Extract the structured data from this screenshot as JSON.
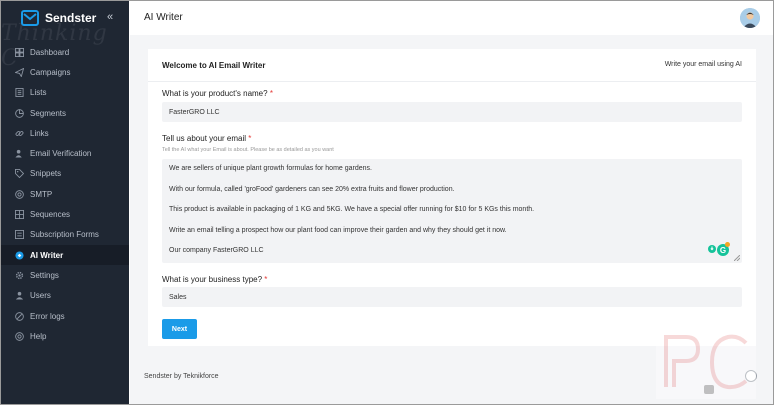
{
  "sidebar": {
    "brand": "Sendster",
    "watermark": "Thinking C",
    "items": [
      {
        "label": "Dashboard",
        "icon": "dashboard-icon",
        "active": false
      },
      {
        "label": "Campaigns",
        "icon": "paper-plane-icon",
        "active": false
      },
      {
        "label": "Lists",
        "icon": "list-icon",
        "active": false
      },
      {
        "label": "Segments",
        "icon": "pie-chart-icon",
        "active": false
      },
      {
        "label": "Links",
        "icon": "link-icon",
        "active": false
      },
      {
        "label": "Email Verification",
        "icon": "user-check-icon",
        "active": false
      },
      {
        "label": "Snippets",
        "icon": "tag-icon",
        "active": false
      },
      {
        "label": "SMTP",
        "icon": "at-sign-icon",
        "active": false
      },
      {
        "label": "Sequences",
        "icon": "grid-icon",
        "active": false
      },
      {
        "label": "Subscription Forms",
        "icon": "form-icon",
        "active": false
      },
      {
        "label": "AI Writer",
        "icon": "ai-icon",
        "active": true
      },
      {
        "label": "Settings",
        "icon": "gear-icon",
        "active": false
      },
      {
        "label": "Users",
        "icon": "user-icon",
        "active": false
      },
      {
        "label": "Error logs",
        "icon": "error-icon",
        "active": false
      },
      {
        "label": "Help",
        "icon": "help-icon",
        "active": false
      }
    ]
  },
  "header": {
    "title": "AI Writer"
  },
  "card": {
    "title": "Welcome to AI Email Writer",
    "subtitle": "Write your email using AI",
    "product_label": "What is your product's name?",
    "product_value": "FasterGRO LLC",
    "email_label": "Tell us about your email",
    "email_help": "Tell the AI what your Email is about. Please be as detailed as you want",
    "email_lines": [
      "We are sellers of unique plant growth formulas for home gardens.",
      "With our formula, called 'groFood' gardeners can see 20% extra fruits and flower production.",
      "This product is available in packaging of 1 KG and 5KG. We have a special offer running for $10 for 5 KGs this month.",
      "Write an email telling a prospect how our plant food can improve their garden and why they should get it now.",
      "Our company FasterGRO LLC"
    ],
    "business_label": "What is your business type?",
    "business_value": "Sales",
    "required_mark": "*",
    "next_label": "Next"
  },
  "footer": {
    "text": "Sendster by Teknikforce"
  },
  "colors": {
    "sidebar_bg": "#1f2733",
    "accent": "#1a9be8",
    "required": "#e53935"
  }
}
